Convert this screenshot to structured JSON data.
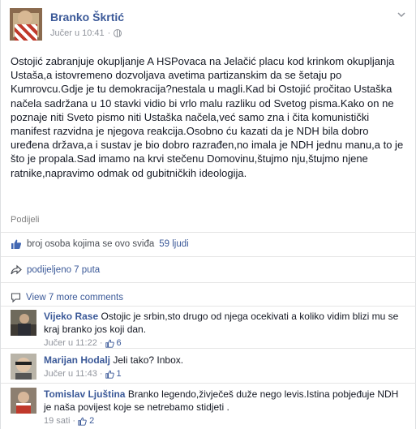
{
  "post": {
    "author": "Branko Škrtić",
    "timestamp": "Jučer u 10:41",
    "separator": "·",
    "text": "Ostojić zabranjuje okupljanje A HSPovaca na Jelačić placu kod krinkom okupljanja Ustaša,a istovremeno dozvoljava avetima partizanskim da se šetaju po Kumrovcu.Gdje je tu demokracija?nestala u magli.Kad bi Ostojić pročitao Ustaška načela sadržana u 10 stavki vidio bi vrlo malu razliku od Svetog pisma.Kako on ne poznaje niti Sveto pismo niti Ustaška načela,već samo zna i čita komunistički manifest razvidna je njegova reakcija.Osobno ću kazati da je NDH bila dobro uređena država,a i sustav je bio dobro razrađen,no imala je NDH jednu manu,a to je što je propala.Sad imamo na krvi stečenu Domovinu,štujmo nju,štujmo njene ratnike,napravimo odmak od gubitničkih ideologija.",
    "share_label": "Podijeli"
  },
  "likes": {
    "text": "broj osoba kojima se ovo sviđa",
    "count_label": "59 ljudi"
  },
  "shares": {
    "text": "podijeljeno 7 puta"
  },
  "comments_header": {
    "view_more": "View 7 more comments"
  },
  "comments": [
    {
      "name": "Vijeko Rase",
      "text": "Ostojic je srbin,sto drugo od njega ocekivati a koliko vidim blizi mu se kraj branko jos koji dan.",
      "time": "Jučer u 11:22",
      "likes": "6"
    },
    {
      "name": "Marijan Hodalj",
      "text": "Jeli tako? Inbox.",
      "time": "Jučer u 11:43",
      "likes": "1"
    },
    {
      "name": "Tomislav Ljuština",
      "text": "Branko legendo,živječeš duže nego levis.Istina pobjeđuje NDH je naša povijest koje se netrebamo stidjeti .",
      "time": "19 sati",
      "likes": "2"
    }
  ],
  "colors": {
    "link": "#3b5998",
    "meta": "#90949c",
    "text": "#141823"
  },
  "icons": {
    "globe": "globe-icon",
    "like": "thumbs-up-icon",
    "share": "share-arrow-icon",
    "comment": "comment-bubble-icon",
    "menu": "chevron-down-icon"
  }
}
